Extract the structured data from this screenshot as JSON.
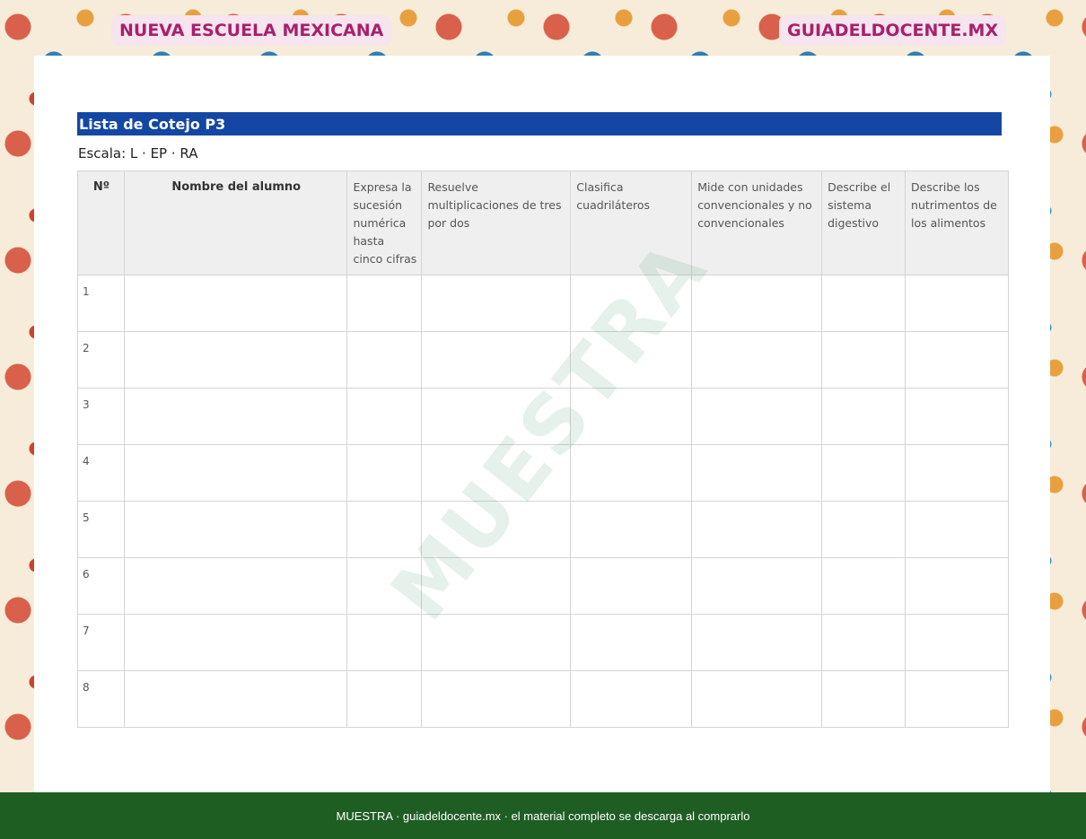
{
  "header": {
    "brand_left": "NUEVA ESCUELA MEXICANA",
    "brand_right": "GUIADELDOCENTE.MX"
  },
  "document": {
    "title": "Lista de Cotejo P3",
    "scale": "Escala: L · EP · RA",
    "watermark": "MUESTRA"
  },
  "table": {
    "columns": [
      "Nº",
      "Nombre del alumno",
      "Expresa la sucesión numérica hasta cinco cifras",
      "Resuelve multiplicaciones de tres por dos",
      "Clasifica cuadriláteros",
      "Mide con unidades convencionales y no convencionales",
      "Describe el sistema digestivo",
      "Describe los nutrimentos de los alimentos"
    ],
    "rows": [
      "1",
      "2",
      "3",
      "4",
      "5",
      "6",
      "7",
      "8"
    ]
  },
  "footer": {
    "text": "MUESTRA · guiadeldocente.mx · el material completo se descarga al comprarlo"
  },
  "colors": {
    "title_bar": "#1447a3",
    "brand_text": "#a8206b",
    "footer_bg": "#1e5e23"
  }
}
